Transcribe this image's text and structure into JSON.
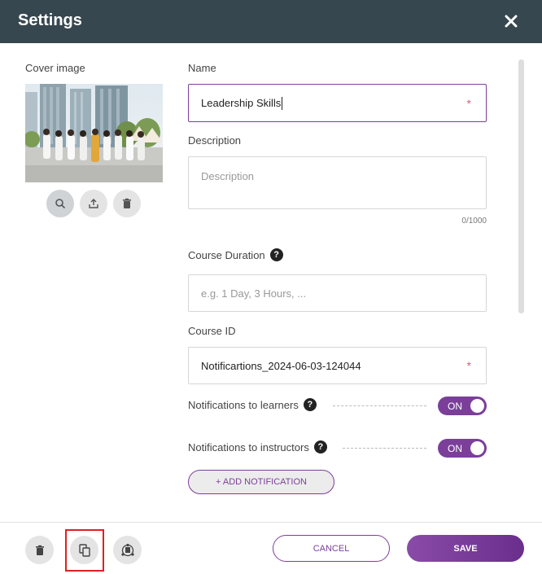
{
  "header": {
    "title": "Settings",
    "close_icon": "close-icon"
  },
  "cover": {
    "label": "Cover image",
    "image_icon": "cover-photo",
    "actions": [
      "search-icon",
      "upload-icon",
      "trash-icon"
    ]
  },
  "form": {
    "name": {
      "label": "Name",
      "value": "Leadership Skills",
      "required_mark": "*"
    },
    "description": {
      "label": "Description",
      "placeholder": "Description",
      "counter": "0/1000"
    },
    "duration": {
      "label": "Course Duration",
      "help": "?",
      "placeholder": "e.g. 1 Day, 3 Hours, ..."
    },
    "course_id": {
      "label": "Course ID",
      "value": "Notificartions_2024-06-03-124044",
      "required_mark": "*"
    },
    "notif_learners": {
      "label": "Notifications to learners",
      "help": "?",
      "toggle": "ON"
    },
    "notif_instructors": {
      "label": "Notifications to instructors",
      "help": "?",
      "toggle": "ON"
    },
    "add_notification": "+ ADD NOTIFICATION"
  },
  "footer": {
    "icons": [
      "trash-icon",
      "copy-icon",
      "publish-icon"
    ],
    "cancel": "CANCEL",
    "save": "SAVE"
  },
  "colors": {
    "header_bg": "#37474f",
    "accent": "#7b3f9a",
    "required": "#e05a7a",
    "highlight": "#e02020"
  }
}
